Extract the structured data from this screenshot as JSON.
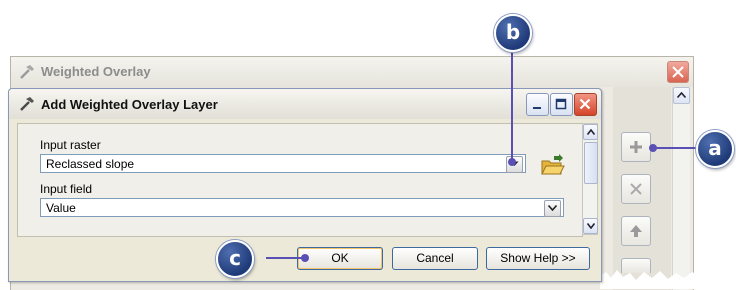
{
  "background_window": {
    "title": "Weighted Overlay",
    "side_buttons": [
      {
        "icon": "plus-icon"
      },
      {
        "icon": "x-icon"
      },
      {
        "icon": "arrow-up-icon"
      }
    ]
  },
  "dialog": {
    "title": "Add Weighted Overlay Layer",
    "input_raster_label": "Input raster",
    "input_raster_value": "Reclassed slope",
    "input_field_label": "Input field",
    "input_field_value": "Value",
    "buttons": {
      "ok": "OK",
      "cancel": "Cancel",
      "help": "Show Help >>"
    }
  },
  "callouts": {
    "a": "a",
    "b": "b",
    "c": "c"
  },
  "colors": {
    "callout": "#1f3a78",
    "callout_line": "#5a4fb4",
    "close_button": "#d4442a"
  }
}
